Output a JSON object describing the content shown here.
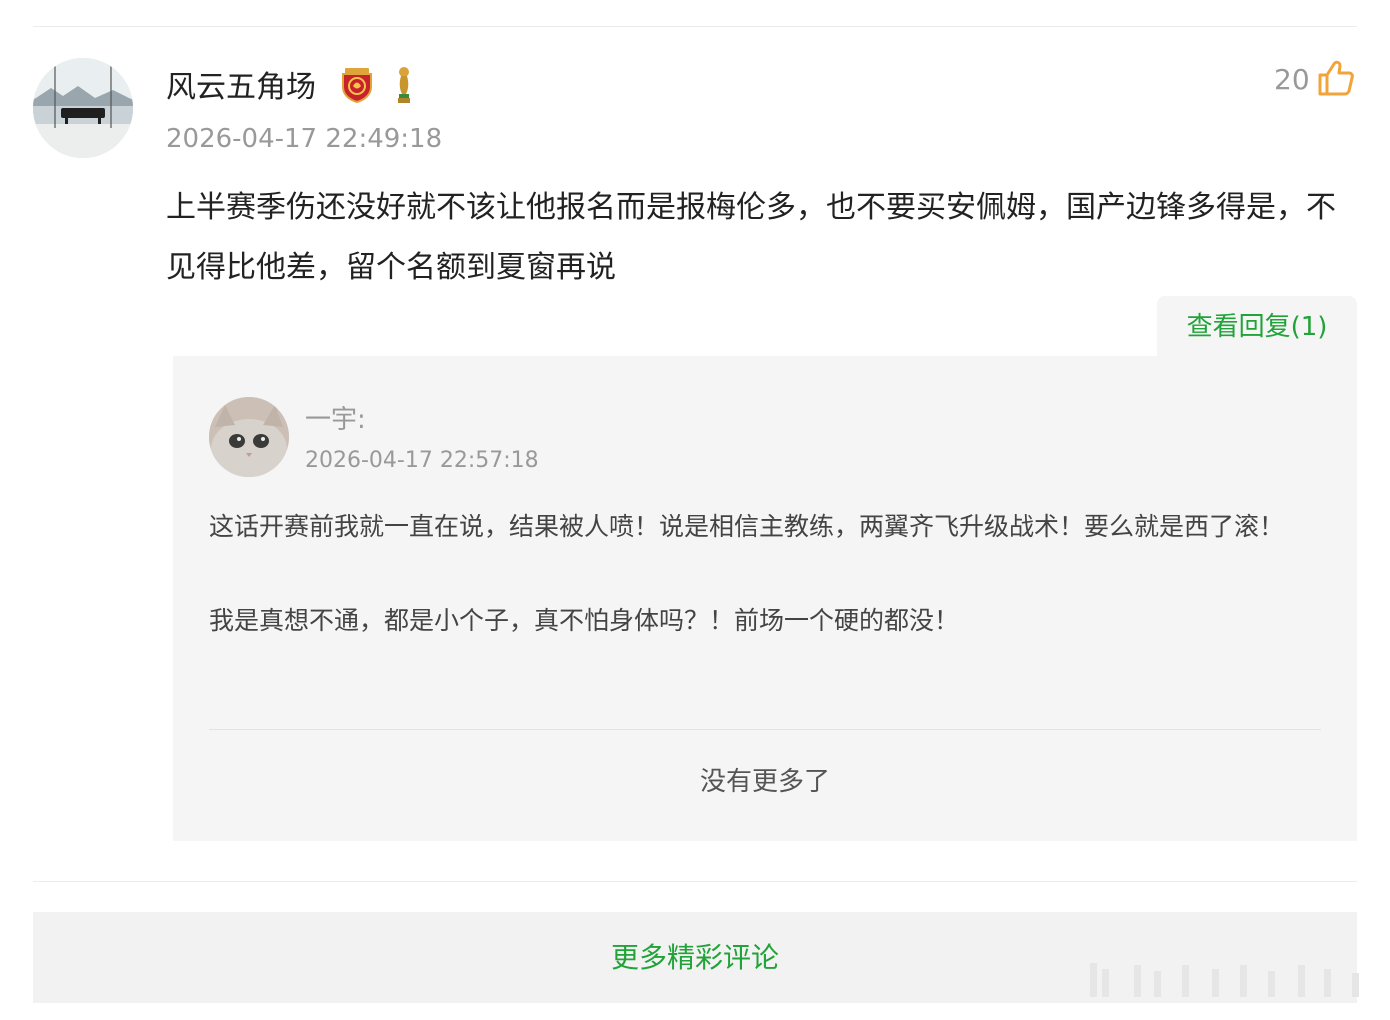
{
  "comment": {
    "username": "风云五角场",
    "timestamp": "2026-04-17 22:49:18",
    "like_count": "20",
    "text": "上半赛季伤还没好就不该让他报名而是报梅伦多，也不要买安佩姆，国产边锋多得是，不见得比他差，留个名额到夏窗再说",
    "badges": [
      "club-shield-badge",
      "trophy-badge"
    ],
    "view_replies_label": "查看回复(1)"
  },
  "reply": {
    "username": "一宇:",
    "timestamp": "2026-04-17 22:57:18",
    "paragraphs": [
      "这话开赛前我就一直在说，结果被人喷！说是相信主教练，两翼齐飞升级战术！要么就是西了滚！",
      "我是真想不通，都是小个子，真不怕身体吗？！前场一个硬的都没！"
    ]
  },
  "replies_footer": "没有更多了",
  "more_comments_label": "更多精彩评论",
  "colors": {
    "accent_green": "#22a33a",
    "like_orange": "#f2a33a",
    "muted": "#999999",
    "panel_bg": "#f5f5f5"
  }
}
